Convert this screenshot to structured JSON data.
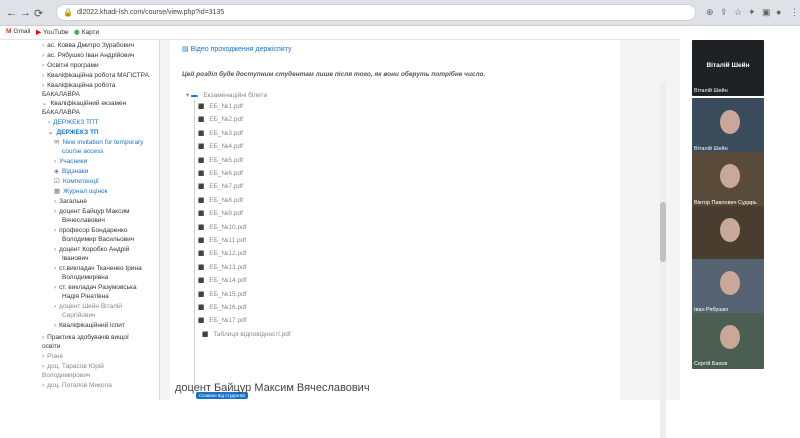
{
  "browser": {
    "url": "dl2022.khadi-lsh.com/course/view.php?id=3135",
    "bookmarks": [
      "Gmail",
      "YouTube",
      "Карти"
    ]
  },
  "sidebar": {
    "items": [
      {
        "text": "ас. Ковва Дмитро Зурабович"
      },
      {
        "text": "ас. Рябушко Іван Андрійович"
      },
      {
        "text": "Освітні програми"
      },
      {
        "text": "Кваліфікаційна робота МАГІСТРА"
      },
      {
        "text": "Кваліфікаційна робота"
      },
      {
        "text": "БАКАЛАВРА"
      },
      {
        "text": "Кваліфікаційний екзамен"
      },
      {
        "text": "БАКАЛАВРА"
      },
      {
        "text": "ДЕРЖЕКЗ ТПТ"
      },
      {
        "text": "ДЕРЖЕКЗ ТП"
      },
      {
        "text": "New invitation for temporary"
      },
      {
        "text": "course access"
      },
      {
        "text": "Учасники"
      },
      {
        "text": "Відзнаки"
      },
      {
        "text": "Компетенції"
      },
      {
        "text": "Журнал оцінок"
      },
      {
        "text": "Загальне"
      },
      {
        "text": "доцент Байцур Максим"
      },
      {
        "text": "Вячеславович"
      },
      {
        "text": "професор Бондаренко"
      },
      {
        "text": "Володимир Васильович"
      },
      {
        "text": "доцент Коробко Андрій"
      },
      {
        "text": "Іванович"
      },
      {
        "text": "ст.викладач Ткаченко Ірина"
      },
      {
        "text": "Володимирівна"
      },
      {
        "text": "ст. викладач Разумовська"
      },
      {
        "text": "Надія Рінатівна"
      },
      {
        "text": "доцент Шейн Віталій"
      },
      {
        "text": "Сергійович"
      },
      {
        "text": "Кваліфікаційний іспит"
      },
      {
        "text": "Практика здобувачів вищої"
      },
      {
        "text": "освіти"
      },
      {
        "text": "Різне"
      },
      {
        "text": "доц. Тарасов Юрій"
      },
      {
        "text": "Володимирович"
      },
      {
        "text": "доц. Потапов Микола"
      }
    ]
  },
  "main": {
    "video_link": "Відео проходження держіспиту",
    "notice": "Цей розділ буде доступним студентам лише після того, як вони оберуть потрібне число.",
    "folder_label": "Екзаменаційні білети",
    "files": [
      "ЕБ_№1.pdf",
      "ЕБ_№2.pdf",
      "ЕБ_№3.pdf",
      "ЕБ_№4.pdf",
      "ЕБ_№5.pdf",
      "ЕБ_№6.pdf",
      "ЕБ_№7.pdf",
      "ЕБ_№8.pdf",
      "ЕБ_№9.pdf",
      "ЕБ_№10.pdf",
      "ЕБ_№11.pdf",
      "ЕБ_№12.pdf",
      "ЕБ_№13.pdf",
      "ЕБ_№14.pdf",
      "ЕБ_№15.pdf",
      "ЕБ_№16.pdf",
      "ЕБ_№17.pdf",
      "Таблиця відповідності.pdf"
    ],
    "badge": "Сховане від студентів",
    "section_heading": "доцент Байцур Максим Вячеславович"
  },
  "video_call": {
    "participants": [
      {
        "name": "Віталій Шейн",
        "color": "#202124",
        "initial_tile": true
      },
      {
        "name": "Віталій Шейн",
        "color": "#3a4b5c"
      },
      {
        "name": "Віктор Павлович Сударь",
        "color": "#5a4a3a"
      },
      {
        "name": "",
        "color": "#4a3d30"
      },
      {
        "name": "Іван Рябушко",
        "color": "#566373"
      },
      {
        "name": "Сергій Бахов",
        "color": "#4a5f52"
      }
    ]
  }
}
